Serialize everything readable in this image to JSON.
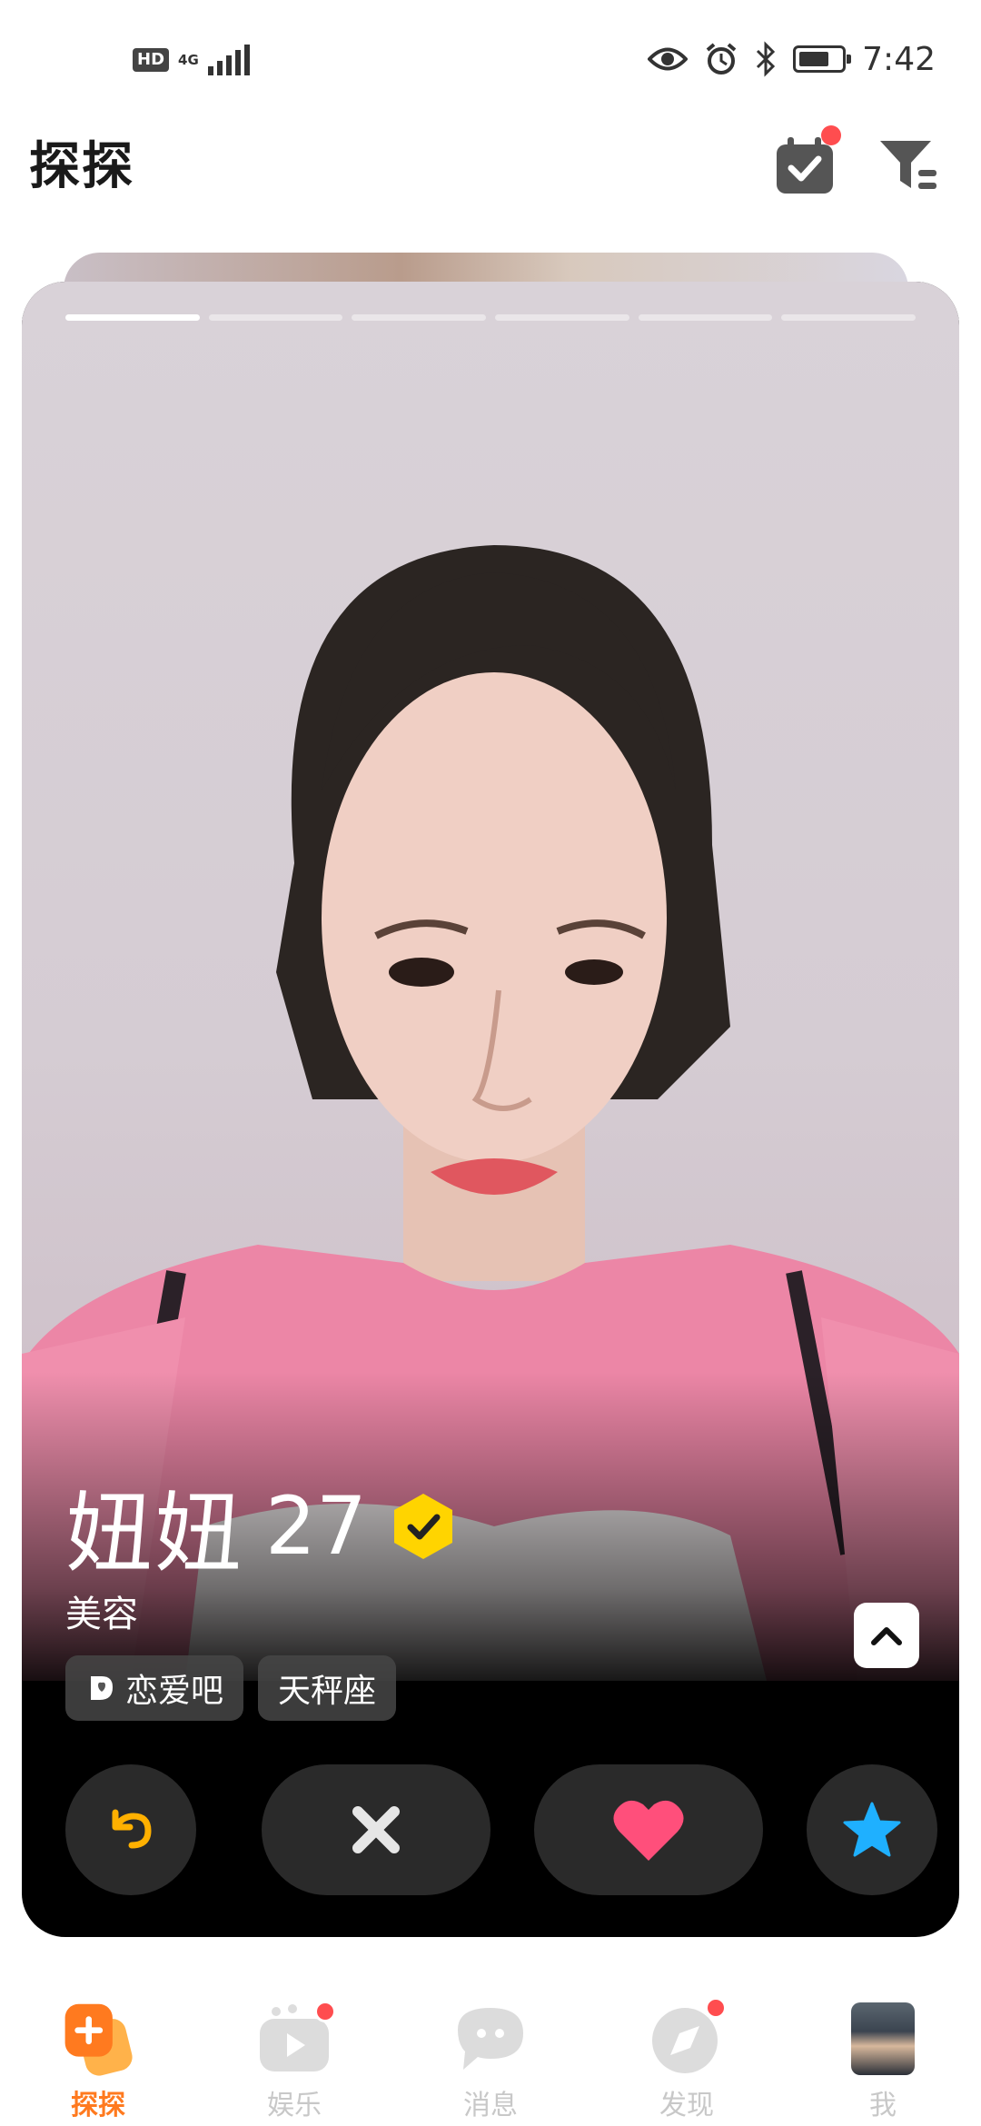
{
  "status_bar": {
    "hd_label": "HD",
    "network_label": "4G",
    "time": "7:42"
  },
  "header": {
    "title": "探探",
    "notification_dot_color": "#ff4d4f"
  },
  "card": {
    "photo_count": 6,
    "active_photo_index": 0,
    "name": "妞妞",
    "age": "27",
    "verified": true,
    "verified_badge_color": "#ffd400",
    "occupation": "美容",
    "tags": [
      {
        "icon": "love-group-icon",
        "label": "恋爱吧"
      },
      {
        "icon": "",
        "label": "天秤座"
      }
    ]
  },
  "actions": {
    "undo_icon": "undo-icon",
    "undo_color": "#ffb000",
    "nope_icon": "close-icon",
    "like_icon": "heart-icon",
    "like_color": "#ff4f7b",
    "superlike_icon": "star-icon",
    "superlike_color": "#1fb0ff"
  },
  "bottom_nav": {
    "items": [
      {
        "label": "探探",
        "icon": "tantan-icon",
        "active": true,
        "badge": false
      },
      {
        "label": "娱乐",
        "icon": "play-icon",
        "active": false,
        "badge": true
      },
      {
        "label": "消息",
        "icon": "chat-icon",
        "active": false,
        "badge": false
      },
      {
        "label": "发现",
        "icon": "compass-icon",
        "active": false,
        "badge": true
      },
      {
        "label": "我",
        "icon": "avatar",
        "active": false,
        "badge": false
      }
    ],
    "active_color": "#ff7a1f"
  }
}
